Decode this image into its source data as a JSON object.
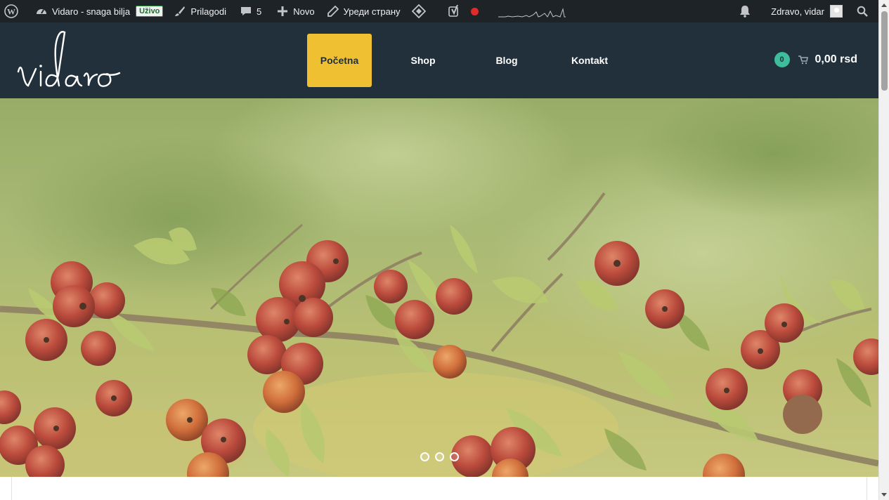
{
  "adminbar": {
    "site_name": "Vidaro - snaga bilja",
    "live_badge": "Uživo",
    "customize": "Prilagodi",
    "comments_count": "5",
    "new_label": "Novo",
    "edit_page": "Уреди страну",
    "greeting": "Zdravo, vidar",
    "icons": [
      "wordpress-icon",
      "dashboard-icon",
      "brush-icon",
      "comment-icon",
      "plus-icon",
      "pencil-icon",
      "diamond-icon",
      "yoast-icon",
      "record-icon",
      "bell-icon",
      "search-icon"
    ]
  },
  "header": {
    "logo_text": "vidaro",
    "nav": [
      "Početna",
      "Shop",
      "Blog",
      "Kontakt"
    ],
    "active_nav": "Početna",
    "cart_count": "0",
    "cart_total": "0,00 rsd",
    "colors": {
      "header_bg": "#21303a",
      "active_bg": "#efc032",
      "cart_badge": "#3dbd9c"
    }
  },
  "hero": {
    "slides": 3,
    "active_slide": 1
  }
}
